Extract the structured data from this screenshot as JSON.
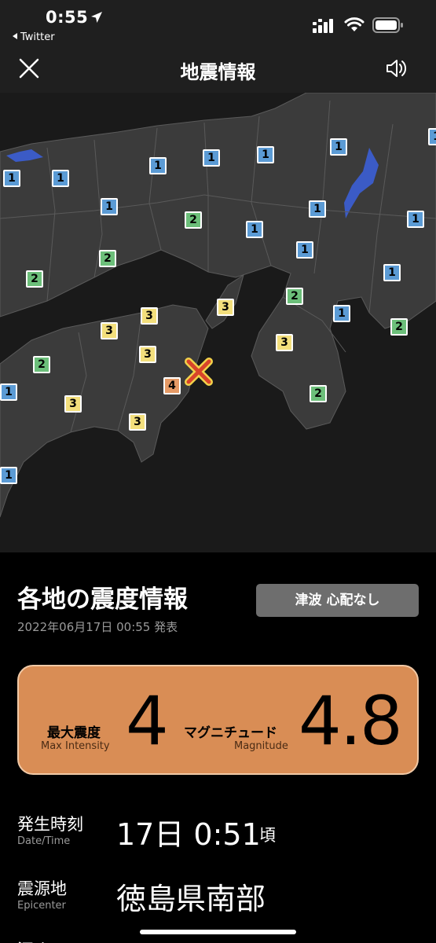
{
  "status_bar": {
    "time": "0:55",
    "back_app": "Twitter"
  },
  "header": {
    "title": "地震情報"
  },
  "map": {
    "intensity_colors": {
      "1": "#5b9bd5",
      "2": "#6cbf7a",
      "3": "#f3df7c",
      "4": "#e59a66"
    },
    "epicenter_marker": "x-mark-icon",
    "station_intensities": [
      "1",
      "1",
      "1",
      "1",
      "1",
      "1",
      "1",
      "1",
      "1",
      "1",
      "1",
      "1",
      "1",
      "1",
      "2",
      "2",
      "2",
      "2",
      "2",
      "2",
      "2",
      "3",
      "3",
      "3",
      "3",
      "3",
      "3",
      "3",
      "4"
    ]
  },
  "info": {
    "section_title": "各地の震度情報",
    "issued": "2022年06月17日 00:55 発表",
    "tsunami": "津波 心配なし",
    "max_intensity_label_ja": "最大震度",
    "max_intensity_label_en": "Max Intensity",
    "max_intensity_value": "4",
    "magnitude_label_ja": "マグニチュード",
    "magnitude_label_en": "Magnitude",
    "magnitude_value": "4.8",
    "datetime_label_ja": "発生時刻",
    "datetime_label_en": "Date/Time",
    "datetime_value": "17日 0:51",
    "datetime_suffix": "頃",
    "epicenter_label_ja": "震源地",
    "epicenter_label_en": "Epicenter",
    "epicenter_value": "徳島県南部",
    "next_label": "深さ"
  }
}
